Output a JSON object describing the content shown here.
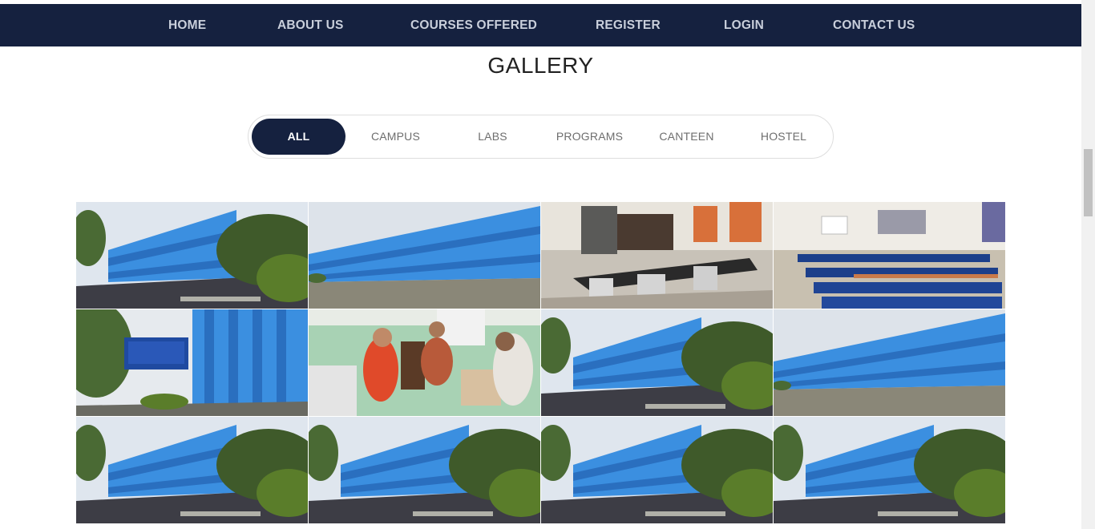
{
  "nav": {
    "home": "HOME",
    "about": "ABOUT US",
    "courses": "COURSES OFFERED",
    "register": "REGISTER",
    "login": "LOGIN",
    "contact": "CONTACT US"
  },
  "gallery": {
    "title": "GALLERY",
    "filters": {
      "all": "ALL",
      "campus": "CAMPUS",
      "labs": "LABS",
      "programs": "PROGRAMS",
      "canteen": "CANTEEN",
      "hostel": "HOSTEL"
    },
    "active_filter": "ALL"
  },
  "colors": {
    "navbar": "#15213f",
    "nav_text": "#c9cfdb",
    "active_chip": "#15213f",
    "building_blue": "#3b8fe0"
  }
}
